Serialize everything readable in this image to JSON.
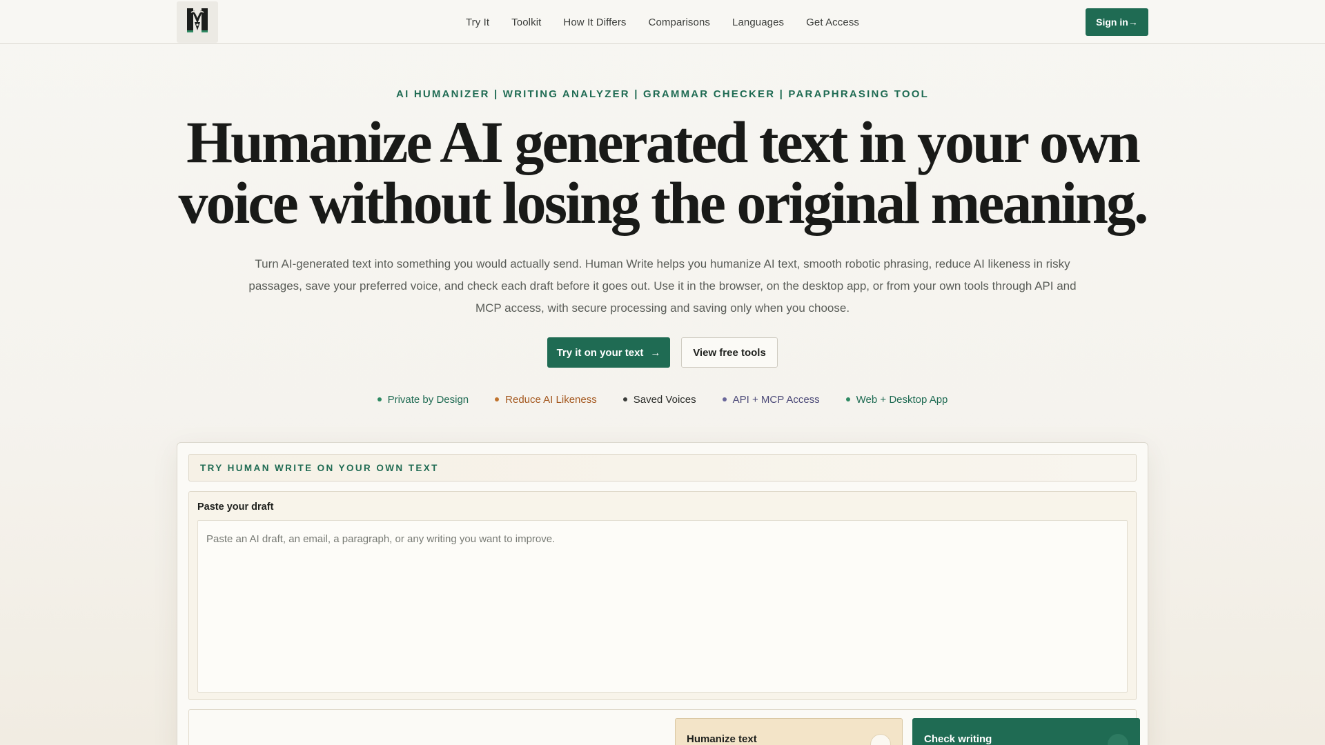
{
  "nav": {
    "logo_icon": "human-write-logo-icon",
    "links": [
      "Try It",
      "Toolkit",
      "How It Differs",
      "Comparisons",
      "Languages",
      "Get Access"
    ],
    "signin_label": "Sign in→"
  },
  "hero": {
    "eyebrow": "AI HUMANIZER | WRITING ANALYZER | GRAMMAR CHECKER | PARAPHRASING TOOL",
    "headline_line1": "Humanize AI generated text in your own",
    "headline_line2": "voice without losing the original meaning.",
    "subtext": "Turn AI-generated text into something you would actually send. Human Write helps you humanize AI text, smooth robotic phrasing, reduce AI likeness in risky passages, save your preferred voice, and check each draft before it goes out. Use it in the browser, on the desktop app, or from your own tools through API and MCP access, with secure processing and saving only when you choose.",
    "cta_primary_label": "Try it on your text",
    "cta_primary_arrow": "→",
    "cta_secondary_label": "View free tools"
  },
  "features": [
    {
      "label": "Private by Design",
      "color": "#1f6b53",
      "dot": "#2f8a63"
    },
    {
      "label": "Reduce AI Likeness",
      "color": "#a4581f",
      "dot": "#c0732e"
    },
    {
      "label": "Saved Voices",
      "color": "#2b2d2a",
      "dot": "#3b3d3a"
    },
    {
      "label": "API + MCP Access",
      "color": "#4c4a78",
      "dot": "#6a679a"
    },
    {
      "label": "Web + Desktop App",
      "color": "#1f6b53",
      "dot": "#2f8a63"
    }
  ],
  "try_panel": {
    "heading": "TRY HUMAN WRITE ON YOUR OWN TEXT",
    "draft_label": "Paste your draft",
    "draft_placeholder": "Paste an AI draft, an email, a paragraph, or any writing you want to improve.",
    "draft_value": "",
    "humanize_label": "Humanize text",
    "check_label": "Check writing",
    "arrow": "→"
  },
  "colors": {
    "accent": "#1f6b53",
    "humanize_bg": "#f3e4c8",
    "page_bg": "#f7f6f2"
  }
}
